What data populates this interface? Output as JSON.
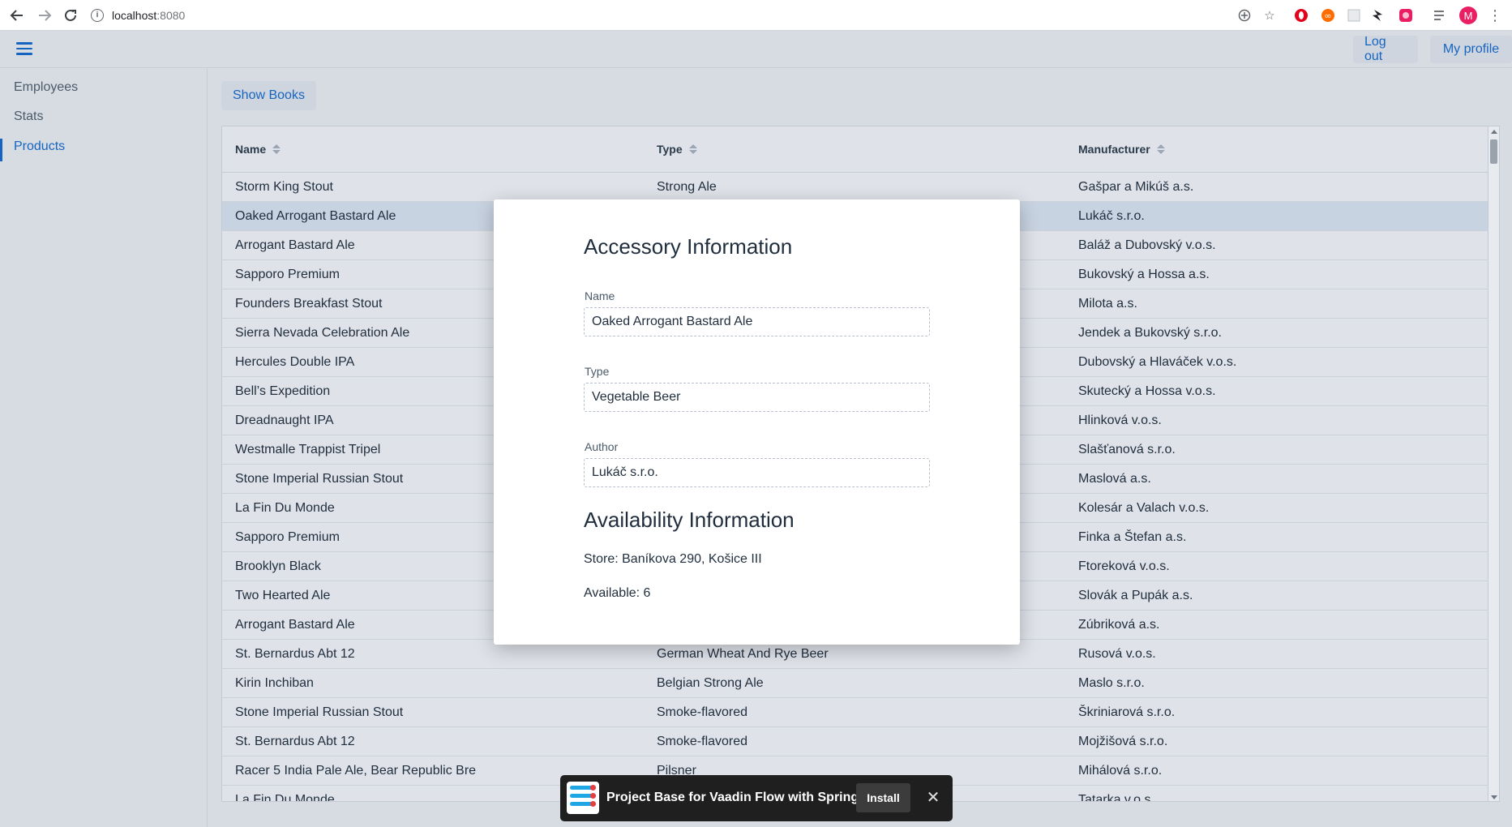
{
  "browser": {
    "url_host": "localhost",
    "url_port": ":8080",
    "avatar_letter": "M"
  },
  "header": {
    "logout_label": "Log out",
    "profile_label": "My profile"
  },
  "sidebar": {
    "items": [
      {
        "label": "Employees"
      },
      {
        "label": "Stats"
      },
      {
        "label": "Products",
        "active": true
      }
    ]
  },
  "main": {
    "show_books_label": "Show Books",
    "grid": {
      "columns": [
        "Name",
        "Type",
        "Manufacturer"
      ],
      "rows": [
        [
          "Storm King Stout",
          "Strong Ale",
          "Gašpar a Mikúš a.s."
        ],
        [
          "Oaked Arrogant Bastard Ale",
          "",
          "Lukáč s.r.o."
        ],
        [
          "Arrogant Bastard Ale",
          "",
          "Baláž a Dubovský v.o.s."
        ],
        [
          "Sapporo Premium",
          "",
          "Bukovský a Hossa a.s."
        ],
        [
          "Founders Breakfast Stout",
          "",
          "Milota a.s."
        ],
        [
          "Sierra Nevada Celebration Ale",
          "",
          "Jendek a Bukovský s.r.o."
        ],
        [
          "Hercules Double IPA",
          "",
          "Dubovský a Hlaváček v.o.s."
        ],
        [
          "Bell’s Expedition",
          "",
          "Skutecký a Hossa v.o.s."
        ],
        [
          "Dreadnaught IPA",
          "",
          "Hlinková v.o.s."
        ],
        [
          "Westmalle Trappist Tripel",
          "",
          "Slašťanová s.r.o."
        ],
        [
          "Stone Imperial Russian Stout",
          "",
          "Maslová a.s."
        ],
        [
          "La Fin Du Monde",
          "",
          "Kolesár a Valach v.o.s."
        ],
        [
          "Sapporo Premium",
          "",
          "Finka a Štefan a.s."
        ],
        [
          "Brooklyn Black",
          "",
          "Ftoreková v.o.s."
        ],
        [
          "Two Hearted Ale",
          "",
          "Slovák a Pupák a.s."
        ],
        [
          "Arrogant Bastard Ale",
          "",
          "Zúbriková a.s."
        ],
        [
          "St. Bernardus Abt 12",
          "German Wheat And Rye Beer",
          "Rusová v.o.s."
        ],
        [
          "Kirin Inchiban",
          "Belgian Strong Ale",
          "Maslo s.r.o."
        ],
        [
          "Stone Imperial Russian Stout",
          "Smoke-flavored",
          "Škriniarová s.r.o."
        ],
        [
          "St. Bernardus Abt 12",
          "Smoke-flavored",
          "Mojžišová s.r.o."
        ],
        [
          "Racer 5 India Pale Ale, Bear Republic Bre",
          "Pilsner",
          "Mihálová s.r.o."
        ],
        [
          "La Fin Du Monde",
          "",
          "Tatarka v.o.s."
        ]
      ],
      "selected_index": 1
    }
  },
  "dialog": {
    "accessory_heading": "Accessory Information",
    "name_label": "Name",
    "name_value": "Oaked Arrogant Bastard Ale",
    "type_label": "Type",
    "type_value": "Vegetable Beer",
    "author_label": "Author",
    "author_value": "Lukáč s.r.o.",
    "availability_heading": "Availability Information",
    "store_text": "Store: Baníkova 290, Košice III",
    "available_text": "Available: 6"
  },
  "install_banner": {
    "title": "Project Base for Vaadin Flow with Spring",
    "install_label": "Install",
    "close_glyph": "✕"
  },
  "colors": {
    "accent": "#1565c0",
    "background": "#d7dce3",
    "selected_row": "#c8d3e1",
    "avatar": "#e91e63"
  }
}
